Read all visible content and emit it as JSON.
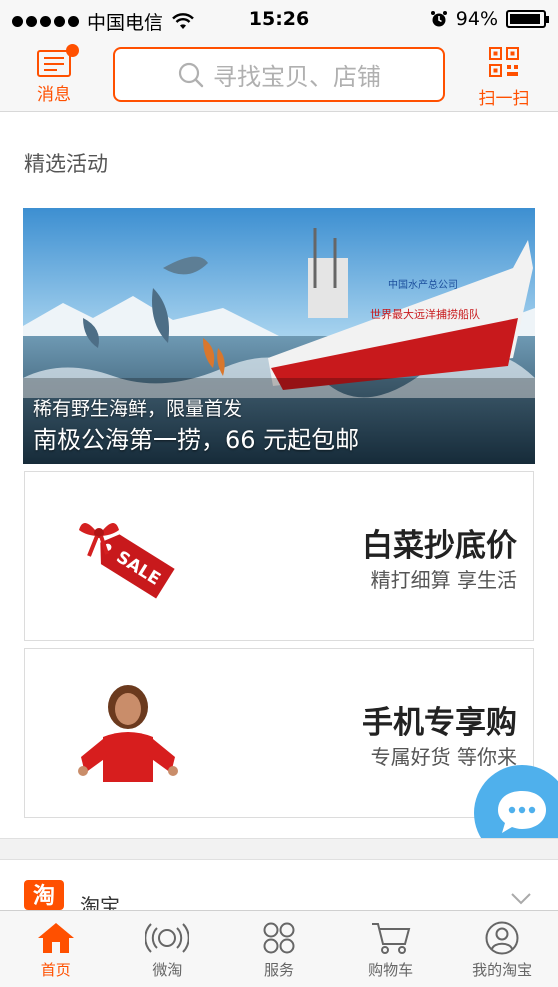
{
  "status": {
    "carrier": "中国电信",
    "time": "15:26",
    "battery": "94%"
  },
  "header": {
    "messages_label": "消息",
    "search_placeholder": "寻找宝贝、店铺",
    "scan_label": "扫一扫"
  },
  "section": {
    "title": "精选活动"
  },
  "banner": {
    "subtitle": "稀有野生海鲜，限量首发",
    "title": "南极公海第一捞，66 元起包邮",
    "ship_company": "中国水产总公司",
    "ship_slogan": "世界最大远洋捕捞船队"
  },
  "cards": [
    {
      "title": "白菜抄底价",
      "subtitle": "精打细算 享生活",
      "tag_text": "SALE"
    },
    {
      "title": "手机专享购",
      "subtitle": "专属好货 等你来"
    }
  ],
  "taobao_row": {
    "logo_char": "淘",
    "label": "淘宝"
  },
  "tabbar": [
    {
      "label": "首页",
      "icon": "home-icon",
      "active": true
    },
    {
      "label": "微淘",
      "icon": "broadcast-icon",
      "active": false
    },
    {
      "label": "服务",
      "icon": "grid-circles-icon",
      "active": false
    },
    {
      "label": "购物车",
      "icon": "cart-icon",
      "active": false
    },
    {
      "label": "我的淘宝",
      "icon": "profile-icon",
      "active": false
    }
  ],
  "colors": {
    "accent": "#ff5000",
    "fab": "#4fb0ec"
  }
}
